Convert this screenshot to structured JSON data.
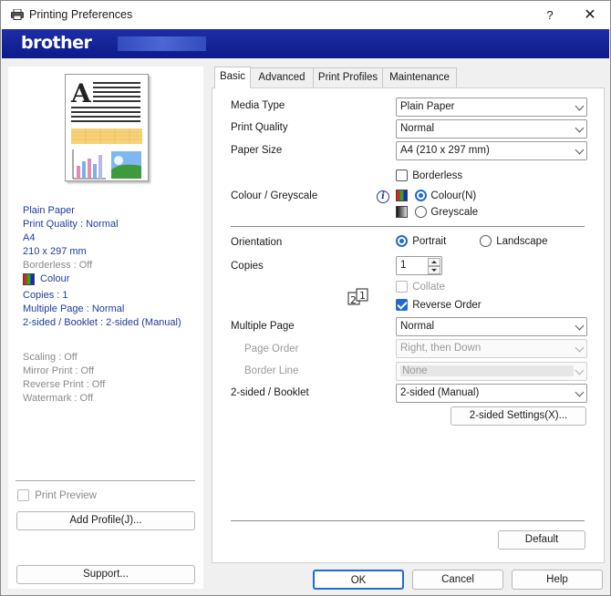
{
  "window": {
    "title": "Printing Preferences",
    "help": "?",
    "close": "✕"
  },
  "banner": {
    "brand": "brother"
  },
  "left": {
    "status_blue": [
      "Plain Paper",
      "Print Quality : Normal",
      "A4",
      "210 x 297 mm"
    ],
    "borderless": "Borderless : Off",
    "colour": "Colour",
    "status_blue2": [
      "Copies : 1",
      "Multiple Page : Normal",
      "2-sided / Booklet : 2-sided (Manual)"
    ],
    "status_gray": [
      "Scaling : Off",
      "Mirror Print : Off",
      "Reverse Print : Off",
      "Watermark : Off"
    ],
    "print_preview": "Print Preview",
    "add_profile": "Add Profile(J)...",
    "support": "Support..."
  },
  "tabs": [
    "Basic",
    "Advanced",
    "Print Profiles",
    "Maintenance"
  ],
  "basic": {
    "media_type_label": "Media Type",
    "media_type_value": "Plain Paper",
    "print_quality_label": "Print Quality",
    "print_quality_value": "Normal",
    "paper_size_label": "Paper Size",
    "paper_size_value": "A4 (210 x 297 mm)",
    "borderless_label": "Borderless",
    "colour_greyscale_label": "Colour / Greyscale",
    "colour_option": "Colour(N)",
    "greyscale_option": "Greyscale",
    "orientation_label": "Orientation",
    "portrait": "Portrait",
    "landscape": "Landscape",
    "copies_label": "Copies",
    "copies_value": "1",
    "collate": "Collate",
    "reverse_order": "Reverse Order",
    "multiple_page_label": "Multiple Page",
    "multiple_page_value": "Normal",
    "page_order_label": "Page Order",
    "page_order_value": "Right, then Down",
    "border_line_label": "Border Line",
    "border_line_value": "None",
    "two_sided_label": "2-sided / Booklet",
    "two_sided_value": "2-sided (Manual)",
    "two_sided_settings": "2-sided Settings(X)...",
    "default": "Default"
  },
  "footer": {
    "ok": "OK",
    "cancel": "Cancel",
    "help": "Help"
  },
  "colors": {
    "banner": "#1e2ea6",
    "accent": "#1f6bd1",
    "info_text": "#1f3c9e"
  }
}
